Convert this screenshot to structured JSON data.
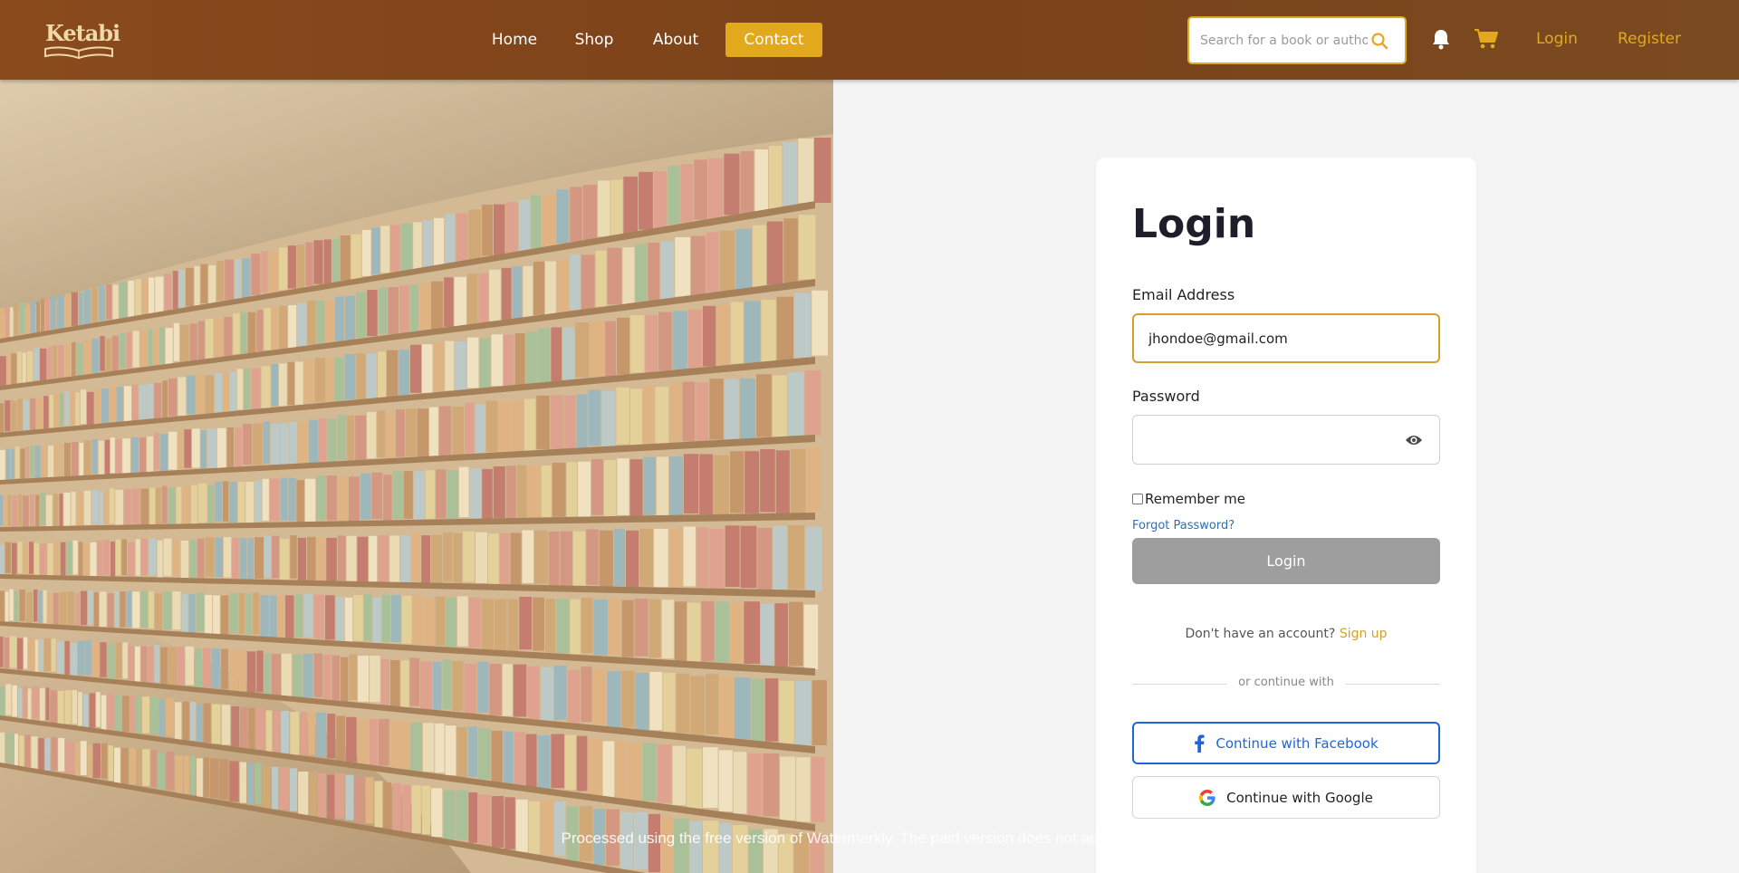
{
  "brand": {
    "name": "Ketabi"
  },
  "nav": {
    "home": "Home",
    "shop": "Shop",
    "about": "About",
    "contact": "Contact"
  },
  "search": {
    "placeholder": "Search for a book or author",
    "value": ""
  },
  "header": {
    "login": "Login",
    "register": "Register"
  },
  "form": {
    "title": "Login",
    "email_label": "Email Address",
    "email_value": "jhondoe@gmail.com",
    "password_label": "Password",
    "password_value": "",
    "remember_label": "Remember me",
    "remember_checked": false,
    "forgot": "Forgot Password?",
    "submit": "Login",
    "no_account": "Don't have an account?",
    "signup": "Sign up",
    "divider": "or continue with",
    "facebook": "Continue with Facebook",
    "google": "Continue with Google"
  },
  "watermark": "Processed using the free version of Watermarkly. The paid version does not add this mark.",
  "colors": {
    "header": "#7b4219",
    "accent": "#e3a91d",
    "facebook": "#1f65d8",
    "button_disabled": "#9e9e9e",
    "link": "#2f6fb5"
  },
  "icons": [
    "search-icon",
    "bell-icon",
    "cart-icon",
    "eye-icon",
    "facebook-icon",
    "google-icon"
  ]
}
